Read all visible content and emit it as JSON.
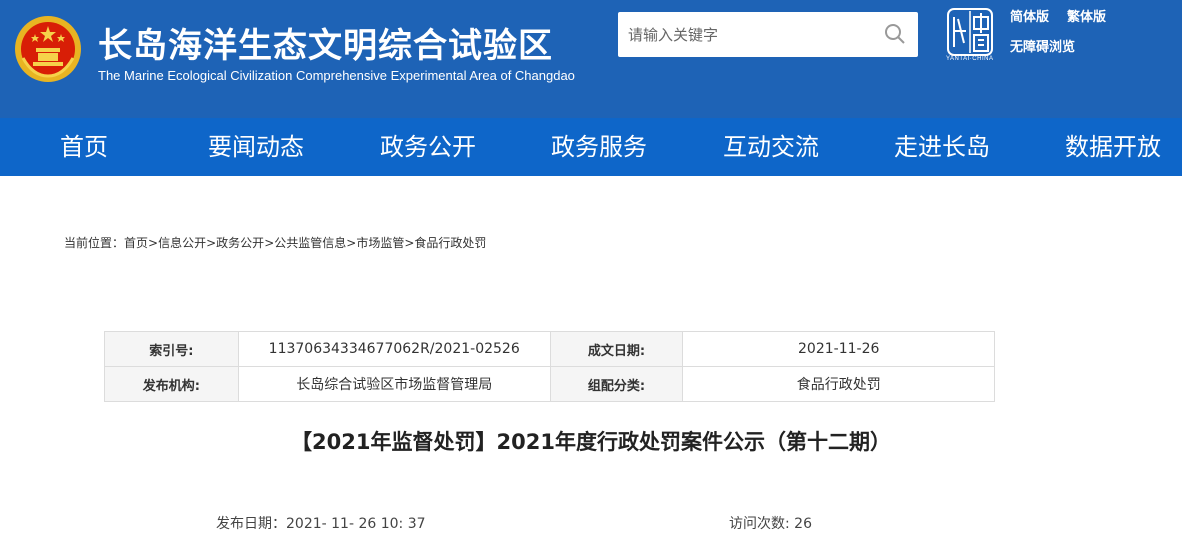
{
  "header": {
    "title": "长岛海洋生态文明综合试验区",
    "subtitle": "The Marine Ecological Civilization Comprehensive Experimental Area of Changdao",
    "search_placeholder": "请输入关键字",
    "seal_caption": "YANTAI·CHINA",
    "links": {
      "simplified": "简体版",
      "traditional": "繁体版",
      "accessible": "无障碍浏览"
    },
    "icons": {
      "emblem": "national-emblem-icon",
      "search": "search-icon",
      "seal": "yantai-seal-logo"
    },
    "colors": {
      "header_bg": "#1e63b6",
      "nav_bg": "#0e66c9"
    }
  },
  "nav": {
    "items": [
      "首页",
      "要闻动态",
      "政务公开",
      "政务服务",
      "互动交流",
      "走进长岛",
      "数据开放"
    ]
  },
  "breadcrumb": {
    "prefix": "当前位置：",
    "items": [
      "首页",
      "信息公开",
      "政务公开",
      "公共监管信息",
      "市场监管",
      "食品行政处罚"
    ],
    "separator": ">"
  },
  "meta": {
    "index_label": "索引号:",
    "index_value": "11370634334677062R/2021-02526",
    "date_label": "成文日期:",
    "date_value": "2021-11-26",
    "publisher_label": "发布机构:",
    "publisher_value": "长岛综合试验区市场监督管理局",
    "category_label": "组配分类:",
    "category_value": "食品行政处罚"
  },
  "article": {
    "title": "【2021年监督处罚】2021年度行政处罚案件公示（第十二期）",
    "publish_label": "发布日期：",
    "publish_value": "2021- 11- 26 10: 37",
    "visits_label": "访问次数:",
    "visits_value": "26"
  }
}
